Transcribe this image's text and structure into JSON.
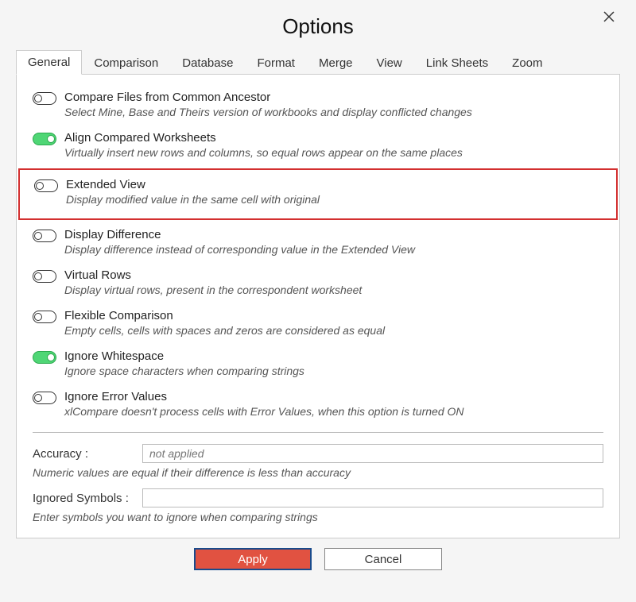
{
  "dialog": {
    "title": "Options"
  },
  "tabs": [
    {
      "label": "General"
    },
    {
      "label": "Comparison"
    },
    {
      "label": "Database"
    },
    {
      "label": "Format"
    },
    {
      "label": "Merge"
    },
    {
      "label": "View"
    },
    {
      "label": "Link Sheets"
    },
    {
      "label": "Zoom"
    }
  ],
  "options": [
    {
      "title": "Compare Files from Common Ancestor",
      "desc": "Select Mine, Base and Theirs version of workbooks and display conflicted changes",
      "on": false
    },
    {
      "title": "Align Compared Worksheets",
      "desc": "Virtually insert new rows and columns, so equal rows appear on the same places",
      "on": true
    },
    {
      "title": "Extended View",
      "desc": "Display modified value in the same cell with original",
      "on": false,
      "highlight": true
    },
    {
      "title": "Display Difference",
      "desc": "Display difference instead of corresponding value in the Extended View",
      "on": false
    },
    {
      "title": "Virtual Rows",
      "desc": "Display virtual rows, present in the correspondent worksheet",
      "on": false
    },
    {
      "title": "Flexible Comparison",
      "desc": "Empty cells, cells with spaces and zeros are considered as equal",
      "on": false
    },
    {
      "title": "Ignore Whitespace",
      "desc": "Ignore space characters when comparing strings",
      "on": true
    },
    {
      "title": "Ignore Error Values",
      "desc": "xlCompare doesn't process cells with Error Values, when this option is turned ON",
      "on": false
    }
  ],
  "fields": {
    "accuracy": {
      "label": "Accuracy :",
      "placeholder": "not applied",
      "desc": "Numeric values are equal if their difference is less than accuracy"
    },
    "ignored": {
      "label": "Ignored Symbols :",
      "placeholder": "",
      "desc": "Enter symbols you want to ignore when comparing strings"
    }
  },
  "buttons": {
    "apply": "Apply",
    "cancel": "Cancel"
  }
}
